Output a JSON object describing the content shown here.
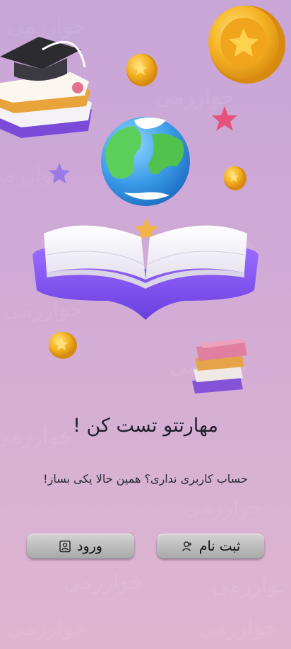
{
  "watermark": {
    "text": "خوارزمی"
  },
  "hero": {
    "illustration": [
      "graduation-cap-books",
      "gold-coin",
      "globe",
      "open-book",
      "stars",
      "book-stack"
    ]
  },
  "headline": "مهارتتو تست کن !",
  "subline": "حساب کاربری نداری؟ همین حالا یکی بساز!",
  "buttons": {
    "login_label": "ورود",
    "login_icon": "user-id-icon",
    "register_label": "ثبت نام",
    "register_icon": "add-user-icon"
  },
  "colors": {
    "background_top": "#c8a6d8",
    "background_bottom": "#dfb6cf",
    "button": "#bdbdbd",
    "text": "#1f1f2e",
    "book_purple": "#8b5cf6",
    "coin_gold": "#f5b324"
  }
}
